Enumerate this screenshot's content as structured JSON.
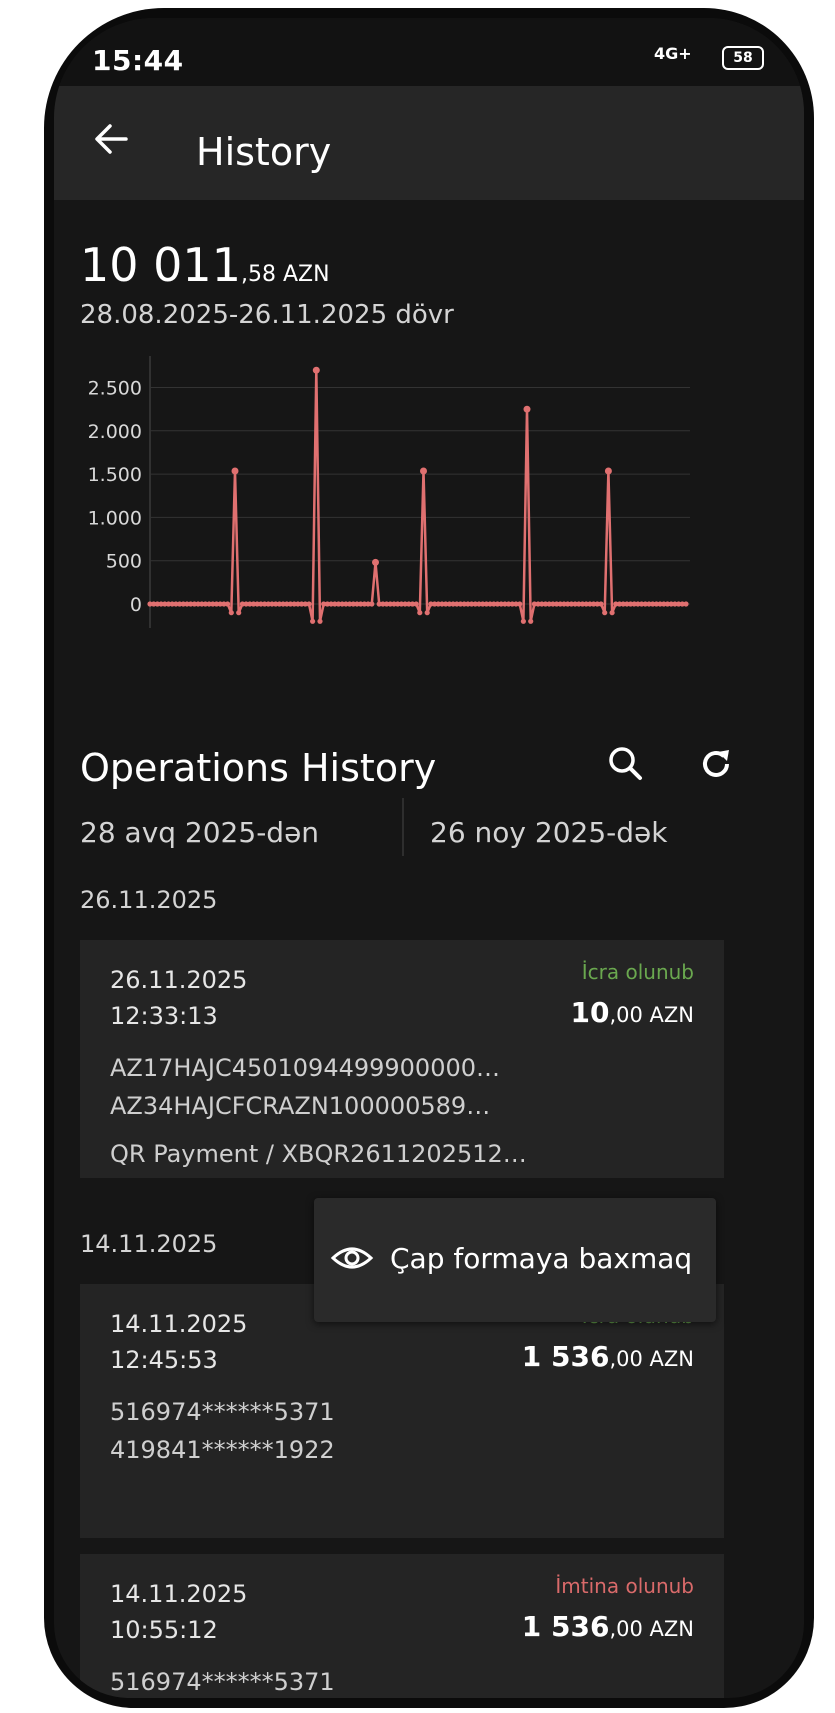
{
  "status": {
    "time": "15:44",
    "network": "4G+",
    "battery": "58"
  },
  "header": {
    "title": "History"
  },
  "summary": {
    "amount_int": "10 011",
    "amount_dec": ",58 AZN",
    "period": "28.08.2025-26.11.2025 dövr"
  },
  "chart_data": {
    "type": "line",
    "title": "",
    "xlabel": "",
    "ylabel": "",
    "y_ticks": [
      "2.500",
      "2.000",
      "1.500",
      "1.000",
      "500",
      "0"
    ],
    "ylim": [
      -250,
      2750
    ],
    "grid": true,
    "color": "#e07070",
    "values": [
      0,
      0,
      0,
      0,
      0,
      0,
      0,
      0,
      0,
      0,
      0,
      0,
      0,
      0,
      0,
      0,
      0,
      0,
      0,
      0,
      0,
      0,
      -100,
      1536,
      -100,
      0,
      0,
      0,
      0,
      0,
      0,
      0,
      0,
      0,
      0,
      0,
      0,
      0,
      0,
      0,
      0,
      0,
      0,
      0,
      -200,
      2700,
      -200,
      0,
      0,
      0,
      0,
      0,
      0,
      0,
      0,
      0,
      0,
      0,
      0,
      0,
      0,
      480,
      0,
      0,
      0,
      0,
      0,
      0,
      0,
      0,
      0,
      0,
      0,
      -100,
      1536,
      -100,
      0,
      0,
      0,
      0,
      0,
      0,
      0,
      0,
      0,
      0,
      0,
      0,
      0,
      0,
      0,
      0,
      0,
      0,
      0,
      0,
      0,
      0,
      0,
      0,
      0,
      -200,
      2250,
      -200,
      0,
      0,
      0,
      0,
      0,
      0,
      0,
      0,
      0,
      0,
      0,
      0,
      0,
      0,
      0,
      0,
      0,
      0,
      0,
      -100,
      1536,
      -100,
      0,
      0,
      0,
      0,
      0,
      0,
      0,
      0,
      0,
      0,
      0,
      0,
      0,
      0,
      0,
      0,
      0,
      0,
      0,
      0
    ]
  },
  "operations": {
    "title": "Operations History",
    "date_from": "28 avq 2025-dən",
    "date_to": "26 noy 2025-dək",
    "groups": [
      {
        "date": "26.11.2025",
        "items": [
          {
            "date": "26.11.2025",
            "time": "12:33:13",
            "status": "İcra olunub",
            "status_color": "#6aa84f",
            "amount_int": "10",
            "amount_dec": ",00 AZN",
            "line1": "AZ17HAJC4501094499900000…",
            "line2": "AZ34HAJCFCRAZN100000589…",
            "line3": "QR Payment / XBQR2611202512…"
          }
        ]
      },
      {
        "date": "14.11.2025",
        "items": [
          {
            "date": "14.11.2025",
            "time": "12:45:53",
            "status": "İcra olunub",
            "status_color": "#6aa84f",
            "amount_int": "1 536",
            "amount_dec": ",00 AZN",
            "line1": "516974******5371",
            "line2": "419841******1922"
          },
          {
            "date": "14.11.2025",
            "time": "10:55:12",
            "status": "İmtina olunub",
            "status_color": "#d96a6a",
            "amount_int": "1 536",
            "amount_dec": ",00 AZN",
            "line1": "516974******5371"
          }
        ]
      }
    ]
  },
  "context_menu": {
    "item_label": "Çap formaya baxmaq",
    "icon": "eye-icon"
  }
}
